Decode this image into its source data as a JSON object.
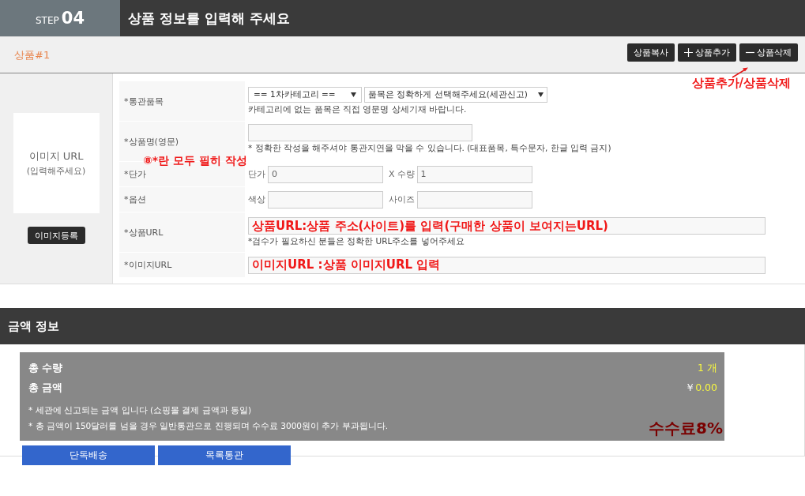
{
  "header": {
    "step_label": "STEP",
    "step_number": "04",
    "title": "상품 정보를 입력해 주세요"
  },
  "product": {
    "label": "상품#1",
    "buttons": [
      {
        "label": "상품복사",
        "kind": "copy"
      },
      {
        "label": "상품추가",
        "kind": "add"
      },
      {
        "label": "상품삭제",
        "kind": "remove"
      }
    ],
    "annotation": "상품추가/상품삭제",
    "image_box": {
      "line1": "이미지 URL",
      "line2": "(입력해주세요)",
      "button": "이미지등록"
    },
    "required_note": "⑧*란 모두 필히 작성",
    "rows": [
      {
        "kind": "category",
        "label": "*통관품목",
        "select1": "== 1차카테고리 ==",
        "select2": "품목은 정확하게 선택해주세요(세관신고)",
        "hint": "카테고리에 없는 품목은 직접 영문명 상세기재 바랍니다."
      },
      {
        "kind": "name",
        "label": "*상품명(영문)",
        "hint": "* 정확한 작성을 해주셔야 통관지연을 막을 수 있습니다. (대표품목, 특수문자, 한글 입력 금지)"
      },
      {
        "kind": "pair",
        "label": "*단가",
        "left_label": "단가",
        "left_value": "0",
        "sep": "X",
        "right_label": "수량",
        "right_value": "1"
      },
      {
        "kind": "pair",
        "label": "*옵션",
        "left_label": "색상",
        "right_label": "사이즈"
      },
      {
        "kind": "url",
        "label": "*상품URL",
        "value": "상품URL:상품 주소(사이트)를 입력(구매한 상품이 보여지는URL)",
        "hint": "*검수가 필요하신 분들은 정확한 URL주소를 넣어주세요"
      },
      {
        "kind": "url",
        "label": "*이미지URL",
        "value": "이미지URL :상품 이미지URL 입력"
      }
    ]
  },
  "amount": {
    "title": "금액 정보",
    "qty_label": "총 수량",
    "qty_value": "1 개",
    "total_label": "총 금액",
    "currency": "￥",
    "total_value": "0.00",
    "notes": [
      "* 세관에 신고되는 금액 입니다 (쇼핑몰 결제 금액과 동일)",
      "* 총 금액이 150달러를 넘을 경우 일반통관으로 진행되며 수수료 3000원이 추가 부과됩니다."
    ],
    "fee_note": "수수료8%",
    "buttons": [
      "단독배송",
      "목록통관"
    ]
  }
}
